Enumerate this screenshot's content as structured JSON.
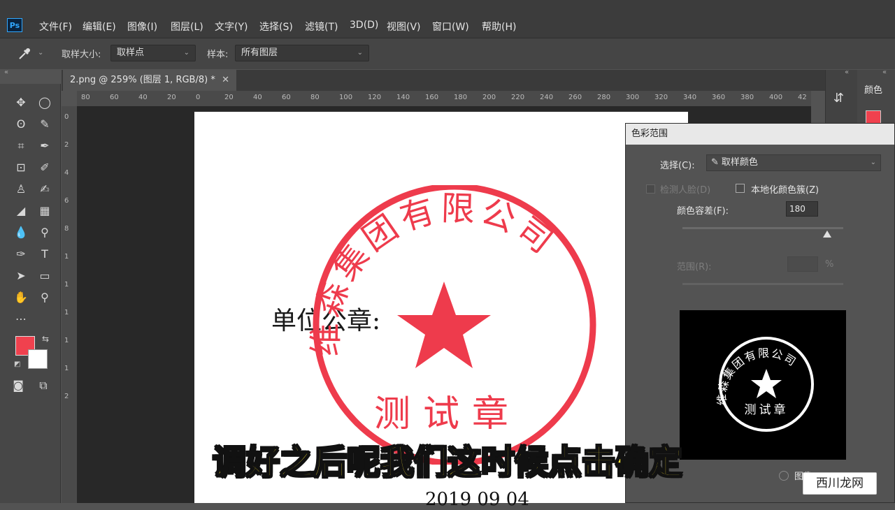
{
  "app": {
    "logo": "Ps"
  },
  "menu": [
    "文件(F)",
    "编辑(E)",
    "图像(I)",
    "图层(L)",
    "文字(Y)",
    "选择(S)",
    "滤镜(T)",
    "3D(D)",
    "视图(V)",
    "窗口(W)",
    "帮助(H)"
  ],
  "options": {
    "sample_size_label": "取样大小:",
    "sample_size_value": "取样点",
    "sample_label": "样本:",
    "sample_value": "所有图层"
  },
  "document": {
    "tab_title": "2.png @ 259% (图层 1, RGB/8) *",
    "tab_close": "✕",
    "ruler_h": [
      "80",
      "60",
      "40",
      "20",
      "0",
      "20",
      "40",
      "60",
      "80",
      "100",
      "120",
      "140",
      "160",
      "180",
      "200",
      "220",
      "240",
      "260",
      "280",
      "300",
      "320",
      "340",
      "360",
      "380",
      "400",
      "42"
    ],
    "ruler_v": [
      "0",
      "2",
      "4",
      "6",
      "8",
      "1",
      "1",
      "1",
      "1",
      "1",
      "2"
    ],
    "text_unit": "单位公章:",
    "stamp_company": "维森集团有限公司",
    "stamp_sub": "测试章",
    "date_partial": "2019  09  04"
  },
  "panel": {
    "title": "颜色"
  },
  "dialog": {
    "title": "色彩范围",
    "select_label": "选择(C):",
    "select_value": "取样颜色",
    "detect_faces": "检测人脸(D)",
    "localized": "本地化颜色簇(Z)",
    "fuzziness_label": "颜色容差(F):",
    "fuzziness_value": "180",
    "fuzziness_level": 0.9,
    "range_label": "范围(R):",
    "range_unit": "%",
    "preview_radio2": "图像"
  },
  "subtitle": "调好之后呢我们这时候点击确定",
  "watermark": "西川龙网",
  "colors": {
    "foreground": "#f0414e",
    "background": "#ffffff",
    "stamp_red": "#ee3b4c",
    "subtitle_yellow": "#ffe733"
  }
}
